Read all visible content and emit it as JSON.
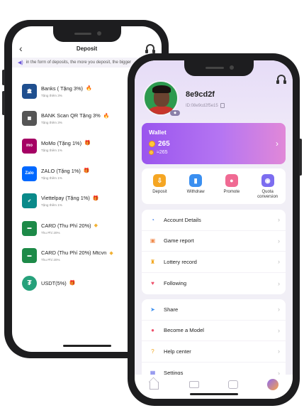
{
  "deposit_screen": {
    "title": "Deposit",
    "marquee": "in the form of deposits, the more you deposit, the bigger",
    "methods": [
      {
        "name": "Banks ( Tặng 3%)",
        "sub": "Tặng thêm 3%",
        "badge": "fire",
        "logo": "bank-icon",
        "color": "#1f4f8f"
      },
      {
        "name": "BANK Scan QR Tặng 3%",
        "sub": "Tặng thêm 3%",
        "badge": "fire",
        "logo": "qr-icon",
        "color": "#555555"
      },
      {
        "name": "MoMo (Tặng 1%)",
        "sub": "Tặng thêm 1%",
        "badge": "gift",
        "logo": "momo-icon",
        "color": "#a50064"
      },
      {
        "name": "ZALO  (Tặng 1%)",
        "sub": "Tặng thêm 1%",
        "badge": "gift",
        "logo": "zalopay-icon",
        "color": "#0068ff"
      },
      {
        "name": "Viettelpay (Tặng 1%)",
        "sub": "Tặng thêm 1%",
        "badge": "gift",
        "logo": "viettelpay-icon",
        "color": "#0a8a8a"
      },
      {
        "name": "CARD  (Thu Phí 20%)",
        "sub": "Thu Phí 20%",
        "badge": "diamond",
        "logo": "viettel-card-icon",
        "color": "#1d8a48"
      },
      {
        "name": "CARD  (Thu Phí 20%)  Mtcvn",
        "sub": "Thu Phí 20%",
        "badge": "diamond",
        "logo": "viettel-card-icon",
        "color": "#1d8a48"
      },
      {
        "name": "USDT(5%)",
        "sub": "",
        "badge": "gift",
        "logo": "tether-icon",
        "color": "#26a17b"
      }
    ]
  },
  "profile_screen": {
    "username": "8e9cd2f",
    "user_id": "ID:08e9cd2f5e15",
    "wallet": {
      "title": "Wallet",
      "balance": "265",
      "sub_balance": "≈265"
    },
    "quick_actions": [
      {
        "label": "Deposit",
        "color": "#f5a623",
        "glyph": "⇩"
      },
      {
        "label": "Withdraw",
        "color": "#3a8ff0",
        "glyph": "▮"
      },
      {
        "label": "Promote",
        "color": "#f06a93",
        "glyph": "●"
      },
      {
        "label": "Quota\nconversion",
        "color": "#7c6df0",
        "glyph": "◉"
      }
    ],
    "menu_group_1": [
      {
        "label": "Account Details",
        "icon": "pie-chart-icon",
        "color": "#3a7be8",
        "glyph": "◔"
      },
      {
        "label": "Game report",
        "icon": "box-icon",
        "color": "#f08a4b",
        "glyph": "▣"
      },
      {
        "label": "Lottery record",
        "icon": "trophy-icon",
        "color": "#f2a51a",
        "glyph": "♜"
      },
      {
        "label": "Following",
        "icon": "heart-icon",
        "color": "#ee4f6a",
        "glyph": "♥"
      }
    ],
    "menu_group_2": [
      {
        "label": "Share",
        "icon": "paper-plane-icon",
        "color": "#3a8ff0",
        "glyph": "➤"
      },
      {
        "label": "Become a Model",
        "icon": "model-icon",
        "color": "#ee4f6a",
        "glyph": "●"
      },
      {
        "label": "Help center",
        "icon": "help-icon",
        "color": "#f2a51a",
        "glyph": "?"
      },
      {
        "label": "Settings",
        "icon": "settings-icon",
        "color": "#6a6fe8",
        "glyph": "▦"
      }
    ]
  }
}
